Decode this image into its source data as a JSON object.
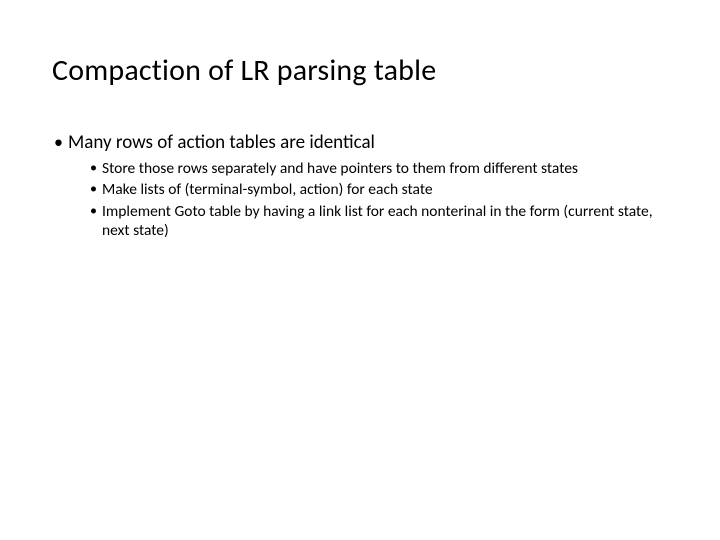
{
  "title": "Compaction of LR parsing table",
  "bullets": {
    "l1": {
      "item0": "Many rows of action tables are identical"
    },
    "l2": {
      "item0": "Store those rows separately and have pointers to them from different states",
      "item1": "Make lists of (terminal-symbol, action) for each state",
      "item2": "Implement Goto table by having a link list for each nonterinal in the form (current state, next state)"
    }
  }
}
